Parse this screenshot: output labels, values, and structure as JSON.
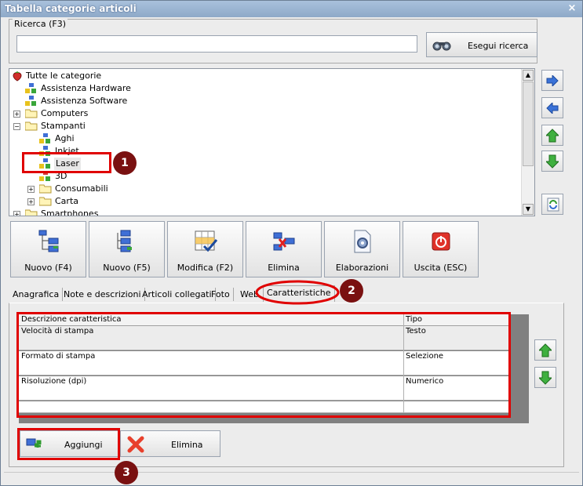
{
  "window": {
    "title": "Tabella categorie articoli",
    "close_glyph": "×"
  },
  "search": {
    "legend": "Ricerca (F3)",
    "value": "",
    "placeholder": "",
    "button_label": "Esegui ricerca"
  },
  "tree": {
    "root": "Tutte le categorie",
    "items": [
      {
        "label": "Assistenza Hardware"
      },
      {
        "label": "Assistenza Software"
      },
      {
        "label": "Computers"
      },
      {
        "label": "Stampanti"
      },
      {
        "label": "Aghi"
      },
      {
        "label": "Inkjet"
      },
      {
        "label": "Laser"
      },
      {
        "label": "3D"
      },
      {
        "label": "Consumabili"
      },
      {
        "label": "Carta"
      },
      {
        "label": "Smartphones"
      }
    ]
  },
  "toolbar": {
    "buttons": [
      {
        "label": "Nuovo (F4)"
      },
      {
        "label": "Nuovo (F5)"
      },
      {
        "label": "Modifica (F2)"
      },
      {
        "label": "Elimina"
      },
      {
        "label": "Elaborazioni"
      },
      {
        "label": "Uscita (ESC)"
      }
    ]
  },
  "tabs": [
    {
      "label": "Anagrafica"
    },
    {
      "label": "Note e descrizioni"
    },
    {
      "label": "Articoli collegati"
    },
    {
      "label": "Foto"
    },
    {
      "label": "Web"
    },
    {
      "label": "Caratteristiche"
    }
  ],
  "grid": {
    "headers": {
      "description": "Descrizione caratteristica",
      "type": "Tipo"
    },
    "rows": [
      {
        "description": "Velocità di stampa",
        "type": "Testo"
      },
      {
        "description": "Formato di stampa",
        "type": "Selezione"
      },
      {
        "description": "Risoluzione (dpi)",
        "type": "Numerico"
      }
    ]
  },
  "bottom_buttons": {
    "add": "Aggiungi",
    "delete": "Elimina"
  },
  "badges": {
    "one": "1",
    "two": "2",
    "three": "3"
  },
  "colors": {
    "annotation_red": "#e00000",
    "badge": "#7a1111",
    "title_bar": "#8ea9c8"
  },
  "icons": {
    "tree_root": "strawberry-icon",
    "tree_category": "blocks-icon",
    "tree_folder": "folder-icon",
    "side_buttons": [
      "arrow-right-icon",
      "arrow-left-icon",
      "arrow-up-icon",
      "arrow-down-icon",
      "refresh-icon"
    ]
  }
}
